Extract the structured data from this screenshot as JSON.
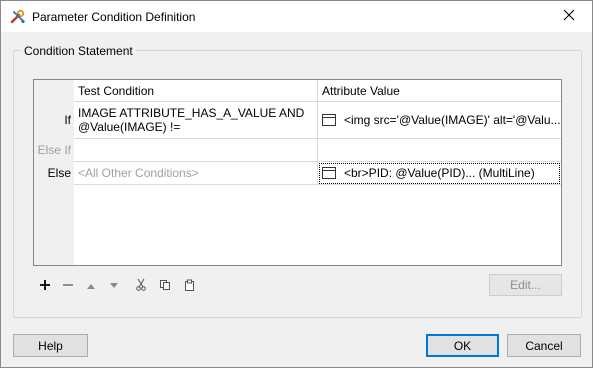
{
  "window": {
    "title": "Parameter Condition Definition",
    "app_icon": "wrench-tools-icon",
    "close_icon": "close-icon"
  },
  "group": {
    "title": "Condition Statement"
  },
  "table": {
    "columns": [
      "Test Condition",
      "Attribute Value"
    ],
    "rows": [
      {
        "label": "If",
        "condition": "IMAGE ATTRIBUTE_HAS_A_VALUE AND @Value(IMAGE) !=",
        "value": "<img src='@Value(IMAGE)' alt='@Valu..."
      },
      {
        "label": "Else If",
        "condition": "",
        "value": ""
      },
      {
        "label": "Else",
        "condition": "<All Other Conditions>",
        "value": "<br>PID: @Value(PID)... (MultiLine)"
      }
    ]
  },
  "toolbar": {
    "icons": [
      "add-icon",
      "remove-icon",
      "move-up-icon",
      "move-down-icon",
      "cut-icon",
      "copy-icon",
      "paste-icon"
    ],
    "edit_label": "Edit..."
  },
  "buttons": {
    "help": "Help",
    "ok": "OK",
    "cancel": "Cancel"
  }
}
